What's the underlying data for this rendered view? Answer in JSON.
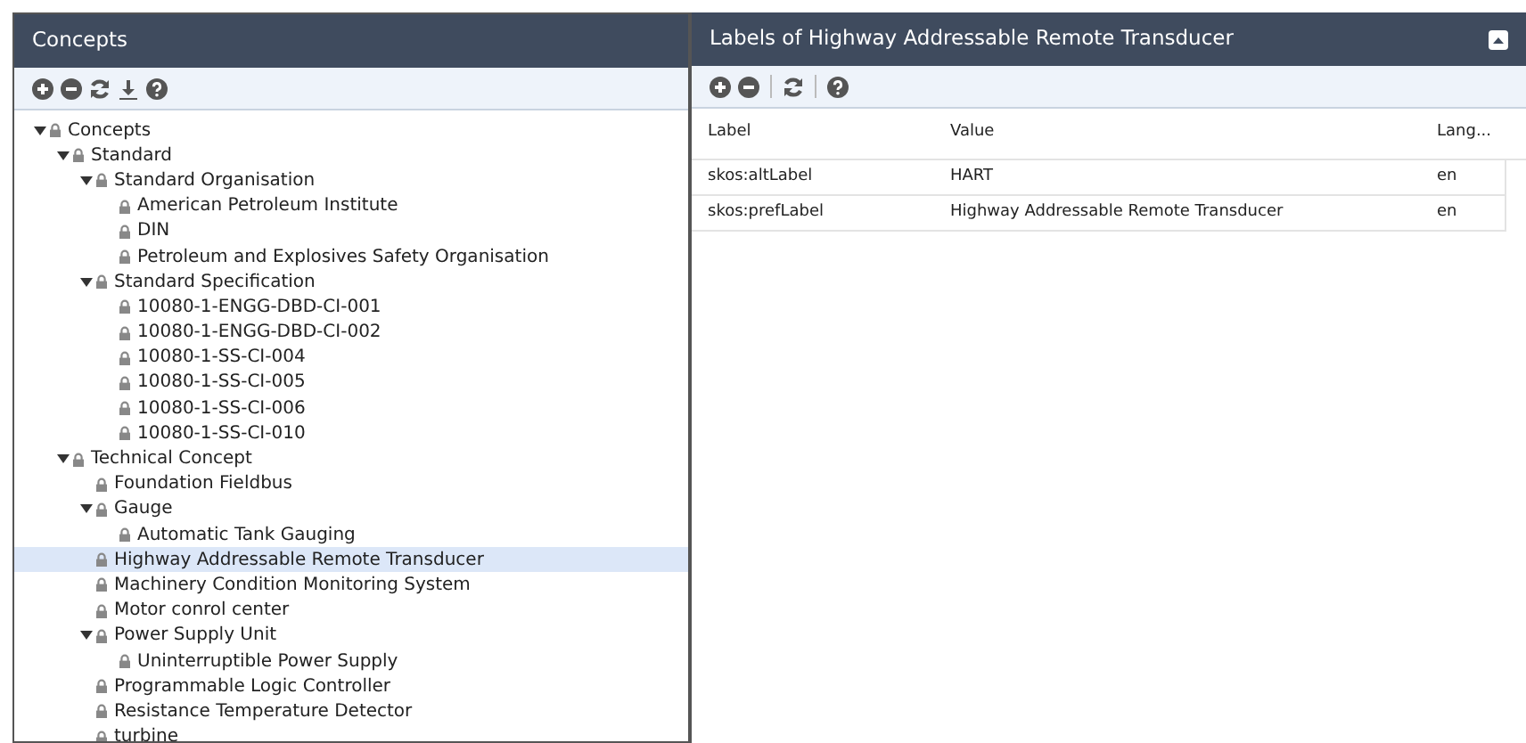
{
  "left_panel": {
    "title": "Concepts",
    "tree": [
      {
        "label": "Concepts",
        "expanded": true,
        "selected": false,
        "children": [
          {
            "label": "Standard",
            "expanded": true,
            "selected": false,
            "children": [
              {
                "label": "Standard Organisation",
                "expanded": true,
                "selected": false,
                "children": [
                  {
                    "label": "American Petroleum Institute",
                    "selected": false
                  },
                  {
                    "label": "DIN",
                    "selected": false
                  },
                  {
                    "label": "Petroleum and Explosives Safety Organisation",
                    "selected": false
                  }
                ]
              },
              {
                "label": "Standard Specification",
                "expanded": true,
                "selected": false,
                "children": [
                  {
                    "label": "10080-1-ENGG-DBD-CI-001",
                    "selected": false
                  },
                  {
                    "label": "10080-1-ENGG-DBD-CI-002",
                    "selected": false
                  },
                  {
                    "label": "10080-1-SS-CI-004",
                    "selected": false
                  },
                  {
                    "label": "10080-1-SS-CI-005",
                    "selected": false
                  },
                  {
                    "label": "10080-1-SS-CI-006",
                    "selected": false
                  },
                  {
                    "label": "10080-1-SS-CI-010",
                    "selected": false
                  }
                ]
              }
            ]
          },
          {
            "label": "Technical Concept",
            "expanded": true,
            "selected": false,
            "children": [
              {
                "label": "Foundation Fieldbus",
                "selected": false
              },
              {
                "label": "Gauge",
                "expanded": true,
                "selected": false,
                "children": [
                  {
                    "label": "Automatic Tank Gauging",
                    "selected": false
                  }
                ]
              },
              {
                "label": "Highway Addressable Remote Transducer",
                "selected": true
              },
              {
                "label": "Machinery Condition Monitoring System",
                "selected": false
              },
              {
                "label": "Motor conrol center",
                "selected": false
              },
              {
                "label": "Power Supply Unit",
                "expanded": true,
                "selected": false,
                "children": [
                  {
                    "label": "Uninterruptible Power Supply",
                    "selected": false
                  }
                ]
              },
              {
                "label": "Programmable Logic Controller",
                "selected": false
              },
              {
                "label": "Resistance Temperature Detector",
                "selected": false
              },
              {
                "label": "turbine",
                "selected": false
              }
            ]
          }
        ]
      }
    ]
  },
  "right_panel": {
    "title": "Labels of Highway Addressable Remote Transducer",
    "table": {
      "columns": [
        "Label",
        "Value",
        "Lang..."
      ],
      "rows": [
        [
          "skos:altLabel",
          "HART",
          "en"
        ],
        [
          "skos:prefLabel",
          "Highway Addressable Remote Transducer",
          "en"
        ]
      ]
    }
  }
}
